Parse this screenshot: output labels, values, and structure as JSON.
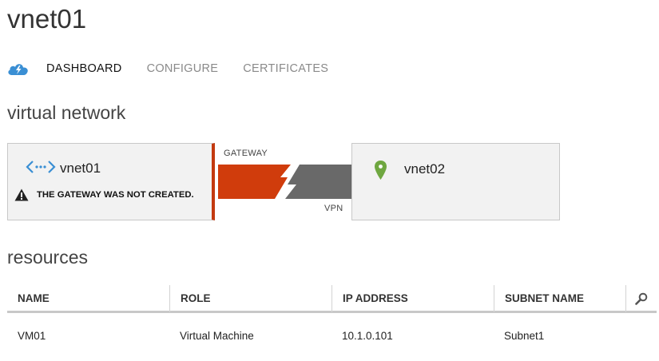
{
  "page": {
    "title": "vnet01"
  },
  "tabs": [
    {
      "label": "DASHBOARD",
      "active": true
    },
    {
      "label": "CONFIGURE",
      "active": false
    },
    {
      "label": "CERTIFICATES",
      "active": false
    }
  ],
  "tab_icon": "azure-cloud-icon",
  "virtual_network": {
    "section_title": "virtual network",
    "local": {
      "name": "vnet01",
      "icon": "vnet-icon",
      "warning": "THE GATEWAY WAS NOT CREATED.",
      "warning_icon": "warning-icon"
    },
    "connection": {
      "gateway_label": "GATEWAY",
      "vpn_label": "VPN",
      "gateway_color": "#d03c0c",
      "vpn_color": "#696969"
    },
    "remote": {
      "name": "vnet02",
      "icon": "location-pin-icon",
      "pin_color": "#6fa740"
    }
  },
  "resources": {
    "section_title": "resources",
    "columns": [
      "NAME",
      "ROLE",
      "IP ADDRESS",
      "SUBNET NAME"
    ],
    "rows": [
      [
        "VM01",
        "Virtual Machine",
        "10.1.0.101",
        "Subnet1"
      ]
    ],
    "search_icon": "search-icon"
  },
  "colors": {
    "accent_cloud": "#3a8fd4",
    "gateway_border": "#c33a10"
  }
}
